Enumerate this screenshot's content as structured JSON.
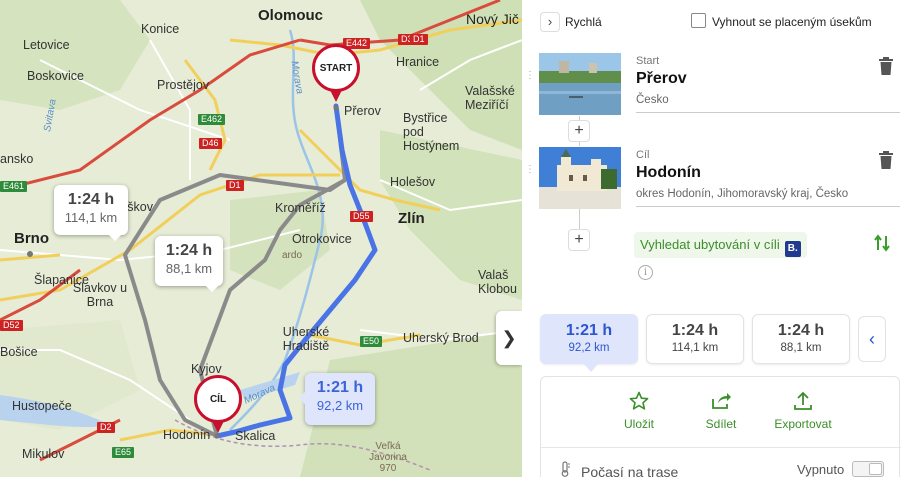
{
  "map": {
    "cities": {
      "olomouc": "Olomouc",
      "novy_jicin": "Nový Jič",
      "konice": "Konice",
      "letovice": "Letovice",
      "boskovice": "Boskovice",
      "prostejov": "Prostějov",
      "hranice": "Hranice",
      "valasske_mezirici": "Valašské Meziříčí",
      "prerov": "Přerov",
      "bystrice": "Bystřice pod Hostýnem",
      "holesov": "Holešov",
      "kromeriz": "Kroměříž",
      "zlin": "Zlín",
      "otrokovice": "Otrokovice",
      "vyskov": "yškov",
      "brno": "Brno",
      "slapanice": "Šlapanice",
      "slavkov": "Slavkov u Brna",
      "uherske_hradiste": "Uherské Hradiště",
      "valasske_klobouky": "Valaš Klobou",
      "uhersky_brod": "Uherský Brod",
      "kyjov": "Kyjov",
      "hodonin": "Hodonín",
      "skalica": "Skalica",
      "hustopece": "Hustopeče",
      "mikulov": "Mikulov",
      "blansko": "ansko",
      "bosice": "Bošice"
    },
    "roads": [
      "E442",
      "D35",
      "D1",
      "E462",
      "D46",
      "E461",
      "D1",
      "D55",
      "D52",
      "D2",
      "E65",
      "E50"
    ],
    "rivers": [
      "Morava",
      "Svitava",
      "Morava"
    ],
    "mountains": {
      "javorina": "Veľká Javorina",
      "javorina_alt": "970",
      "chriby": "ardo"
    },
    "pin_start": "START",
    "pin_end": "CÍL",
    "bubbles": [
      {
        "time": "1:24 h",
        "dist": "114,1 km"
      },
      {
        "time": "1:24 h",
        "dist": "88,1 km"
      },
      {
        "time": "1:21 h",
        "dist": "92,2 km"
      }
    ],
    "collapse_icon": "chevron-right-icon",
    "colors": {
      "selected_route": "#4a74e6",
      "alt_route": "#8a8a8a",
      "pin": "#c8102e"
    }
  },
  "panel": {
    "mode_label": "Rychlá",
    "avoid_tolls_label": "Vyhnout se placeným úsekům",
    "avoid_tolls_checked": false,
    "start": {
      "label": "Start",
      "name": "Přerov",
      "sub": "Česko"
    },
    "end": {
      "label": "Cíl",
      "name": "Hodonín",
      "sub": "okres Hodonín, Jihomoravský kraj, Česko"
    },
    "add_symbol": "+",
    "hotel_label": "Vyhledat ubytování v cíli",
    "hotel_badge": "B.",
    "info_symbol": "i",
    "routes": [
      {
        "time": "1:21 h",
        "dist": "92,2 km",
        "selected": true
      },
      {
        "time": "1:24 h",
        "dist": "114,1 km",
        "selected": false
      },
      {
        "time": "1:24 h",
        "dist": "88,1 km",
        "selected": false
      }
    ],
    "prev_symbol": "‹",
    "actions": [
      {
        "label": "Uložit",
        "icon": "star-icon"
      },
      {
        "label": "Sdílet",
        "icon": "share-icon"
      },
      {
        "label": "Exportovat",
        "icon": "upload-icon"
      }
    ],
    "weather_label": "Počasí na trase",
    "weather_state": "Vypnuto",
    "accent_color": "#3a8f2a",
    "selected_color": "#2d55d0"
  }
}
